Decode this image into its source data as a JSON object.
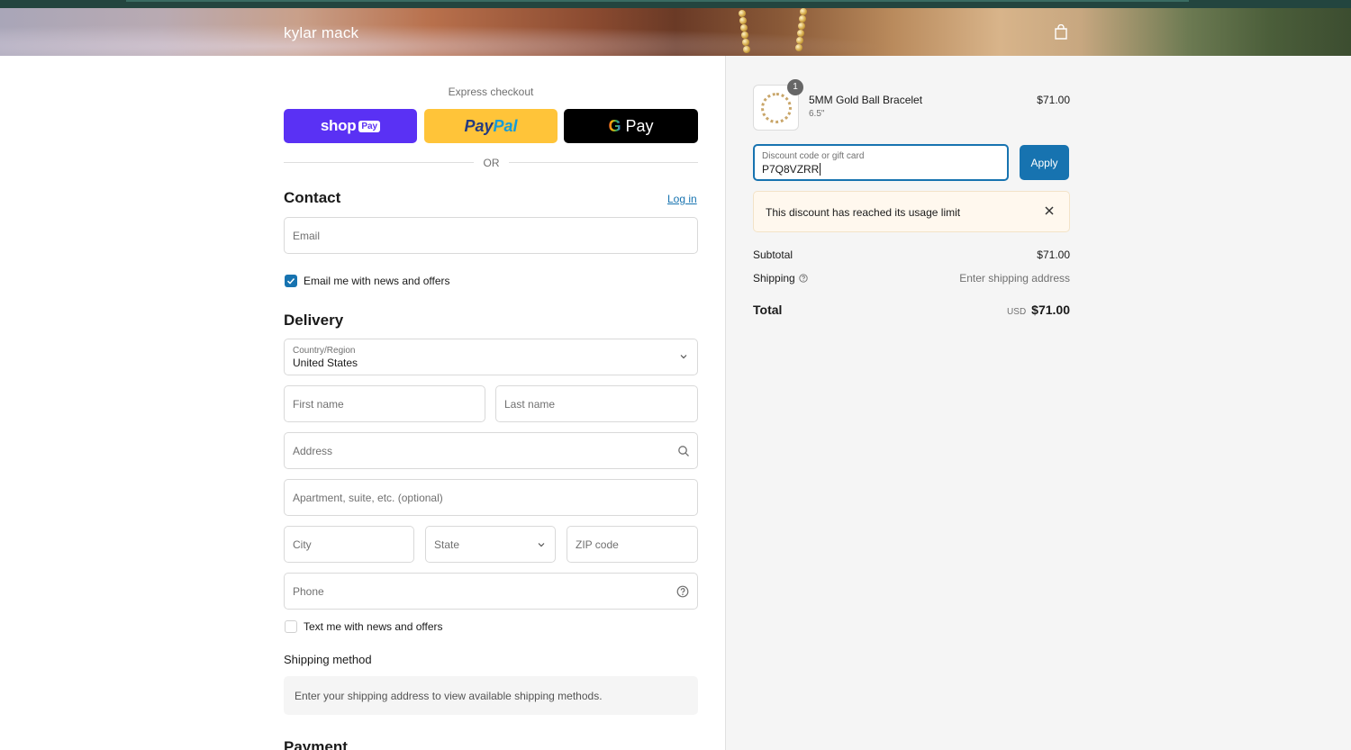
{
  "header": {
    "brand": "kylar mack",
    "cart_icon": "shopping-bag-icon"
  },
  "express": {
    "label": "Express checkout",
    "shop_pay": {
      "word": "shop",
      "badge": "Pay"
    },
    "paypal": {
      "part1": "Pay",
      "part2": "Pal"
    },
    "gpay": {
      "g": "G",
      "word": " Pay"
    },
    "or": "OR"
  },
  "contact": {
    "title": "Contact",
    "login": "Log in",
    "email_placeholder": "Email",
    "news_label": "Email me with news and offers",
    "news_checked": true
  },
  "delivery": {
    "title": "Delivery",
    "country_label": "Country/Region",
    "country_value": "United States",
    "first_name": "First name",
    "last_name": "Last name",
    "address": "Address",
    "apartment": "Apartment, suite, etc. (optional)",
    "city": "City",
    "state": "State",
    "zip": "ZIP code",
    "phone": "Phone",
    "text_label": "Text me with news and offers",
    "text_checked": false
  },
  "shipping_method": {
    "title": "Shipping method",
    "info": "Enter your shipping address to view available shipping methods."
  },
  "payment": {
    "title": "Payment"
  },
  "order": {
    "item": {
      "quantity": "1",
      "name": "5MM Gold Ball Bracelet",
      "variant": "6.5\"",
      "price": "$71.00"
    },
    "discount": {
      "label": "Discount code or gift card",
      "value": "P7Q8VZRR",
      "apply": "Apply"
    },
    "alert": "This discount has reached its usage limit",
    "subtotal_label": "Subtotal",
    "subtotal_value": "$71.00",
    "shipping_label": "Shipping",
    "shipping_value": "Enter shipping address",
    "total_label": "Total",
    "total_currency": "USD",
    "total_value": "$71.00"
  },
  "colors": {
    "accent": "#1773b0",
    "shop_pay": "#5a31f4",
    "paypal": "#ffc439",
    "gpay": "#000000",
    "alert_bg": "#fff8ee"
  }
}
